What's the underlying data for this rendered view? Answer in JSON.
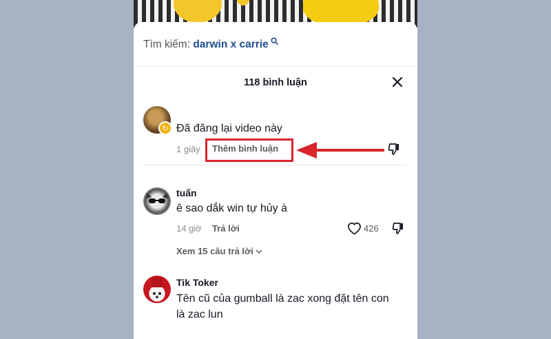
{
  "search": {
    "prefix": "Tìm kiếm:",
    "query": "darwin x carrie"
  },
  "header": {
    "title": "118 bình luận"
  },
  "comments": [
    {
      "text": "Đã đăng lại video này",
      "time": "1 giây",
      "action": "Thêm bình luận"
    },
    {
      "username": "tuấn",
      "text": "ê sao dắk win tự hủy à",
      "time": "14 giờ",
      "action": "Trả lời",
      "likes": "426",
      "view_replies": "Xem 15 câu trả lời"
    },
    {
      "username": "Tik Toker",
      "text_line1": "Tên cũ của gumball là zac xong đặt tên con",
      "text_line2": "là zac lun"
    }
  ],
  "colors": {
    "highlight": "#d8262a",
    "background": "#a7b3c5",
    "query": "#1f4e8c"
  }
}
